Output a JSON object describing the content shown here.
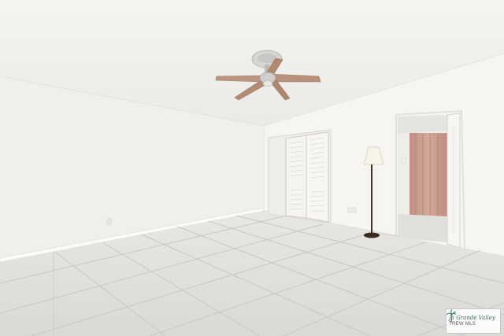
{
  "watermark": {
    "line1": "Ja Grande Valley",
    "line2": "TREW MLS"
  },
  "colors": {
    "ceiling": "#f3f2ef",
    "wall_left": "#f1f0ed",
    "wall_right": "#f6f5f2",
    "floor": "#e2e1de",
    "grout": "#c4c2bd",
    "baseboard": "#fbfbfa",
    "closet_door": "#f3f2ee",
    "curtain": "#c99a8e",
    "lamp_shade": "#f6f1e3",
    "lamp_pole": "#3f2f24",
    "fan_blade": "#b8917a",
    "fan_metal": "#c4c4c0"
  }
}
